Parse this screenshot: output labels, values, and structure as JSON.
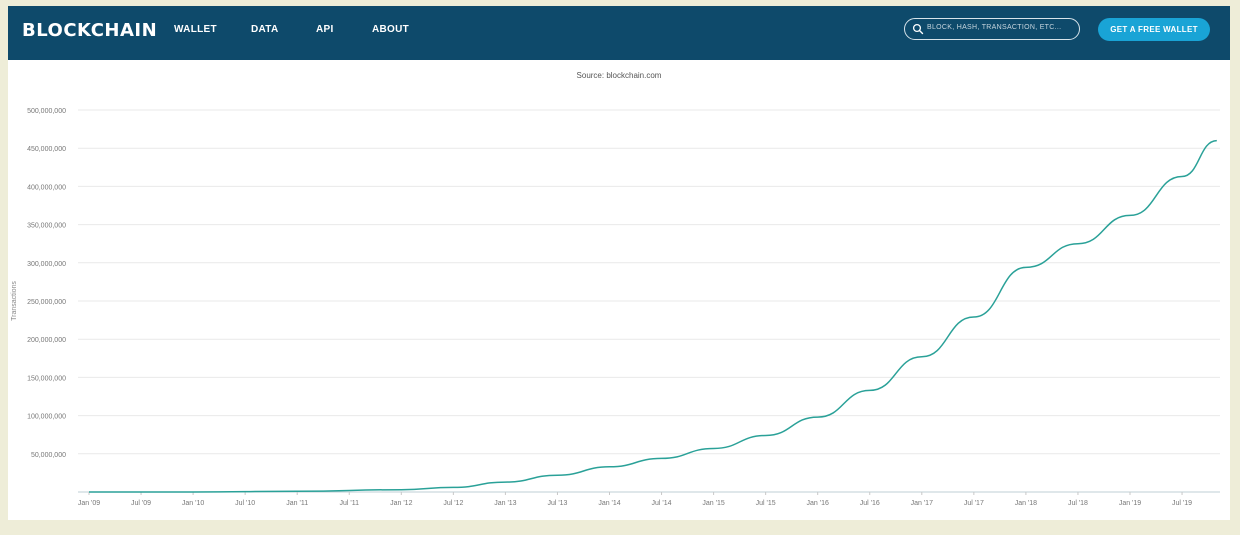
{
  "nav": {
    "logo": "BLOCKCHAIN",
    "links": [
      "WALLET",
      "DATA",
      "API",
      "ABOUT"
    ],
    "search_placeholder": "BLOCK, HASH, TRANSACTION, ETC...",
    "cta_label": "GET A FREE WALLET"
  },
  "colors": {
    "nav_background": "#0e4a6b",
    "cta": "#19a4d6",
    "series_line": "#2aa198",
    "page_background": "#eeedd8"
  },
  "icons": [
    "search-icon"
  ],
  "chart_data": {
    "type": "line",
    "source": "Source: blockchain.com",
    "ylabel": "Transactions",
    "xlabel": "",
    "ylim": [
      0,
      500000000
    ],
    "yticks": [
      50000000,
      100000000,
      150000000,
      200000000,
      250000000,
      300000000,
      350000000,
      400000000,
      450000000,
      500000000
    ],
    "ytick_labels": [
      "50,000,000",
      "100,000,000",
      "150,000,000",
      "200,000,000",
      "250,000,000",
      "300,000,000",
      "350,000,000",
      "400,000,000",
      "450,000,000",
      "500,000,000"
    ],
    "xtick_labels": [
      "Jan '09",
      "Jul '09",
      "Jan '10",
      "Jul '10",
      "Jan '11",
      "Jul '11",
      "Jan '12",
      "Jul '12",
      "Jan '13",
      "Jul '13",
      "Jan '14",
      "Jul '14",
      "Jan '15",
      "Jul '15",
      "Jan '16",
      "Jul '16",
      "Jan '17",
      "Jul '17",
      "Jan '18",
      "Jul '18",
      "Jan '19",
      "Jul '19"
    ],
    "xlim": [
      "2009-01",
      "2019-11"
    ],
    "grid": true,
    "legend": "none",
    "series": [
      {
        "x": [
          "2009-01",
          "2010-01",
          "2011-01",
          "2012-01",
          "2012-07",
          "2013-01",
          "2013-07",
          "2014-01",
          "2014-07",
          "2015-01",
          "2015-07",
          "2016-01",
          "2016-07",
          "2017-01",
          "2017-07",
          "2018-01",
          "2018-07",
          "2019-01",
          "2019-07",
          "2019-11"
        ],
        "values": [
          0,
          0,
          1000000,
          3000000,
          6000000,
          13000000,
          22000000,
          33000000,
          44000000,
          57000000,
          74000000,
          98000000,
          133000000,
          177000000,
          229000000,
          294000000,
          325000000,
          362000000,
          413000000,
          460000000
        ]
      }
    ]
  }
}
